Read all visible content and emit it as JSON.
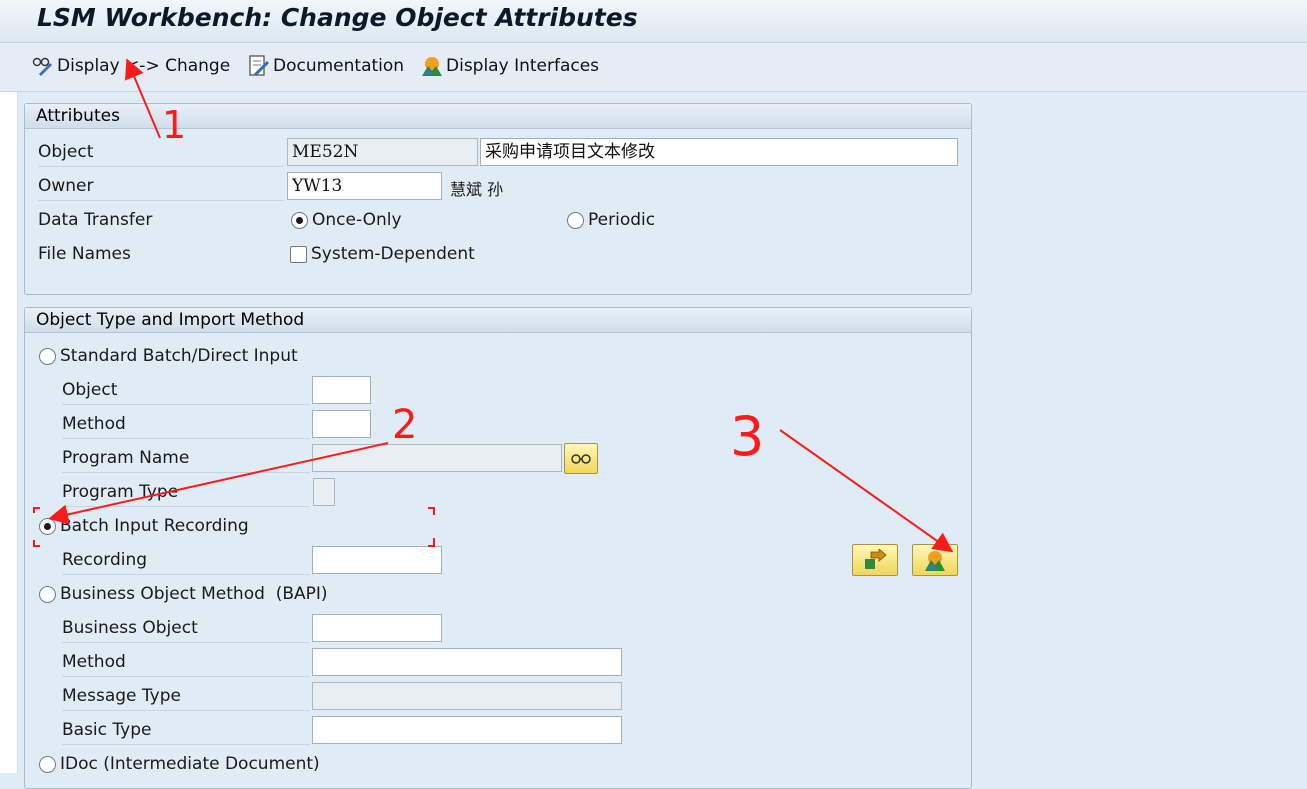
{
  "window": {
    "title": "LSM Workbench: Change Object Attributes"
  },
  "toolbar": {
    "display_change": "Display <-> Change",
    "documentation": "Documentation",
    "display_interfaces": "Display Interfaces"
  },
  "attributes": {
    "heading": "Attributes",
    "object_label": "Object",
    "object_value": "ME52N",
    "object_desc": "采购申请项目文本修改",
    "owner_label": "Owner",
    "owner_value": "YW13",
    "owner_name": "慧斌 孙",
    "data_transfer_label": "Data Transfer",
    "once_only": "Once-Only",
    "periodic": "Periodic",
    "file_names_label": "File Names",
    "system_dependent": "System-Dependent"
  },
  "import": {
    "heading": "Object Type and Import Method",
    "standard_batch": "Standard Batch/Direct Input",
    "object_label": "Object",
    "method_label": "Method",
    "program_name_label": "Program Name",
    "program_type_label": "Program Type",
    "batch_input_recording": "Batch Input Recording",
    "recording_label": "Recording",
    "business_object_method": "Business Object Method  (BAPI)",
    "business_object_label": "Business Object",
    "bapi_method_label": "Method",
    "message_type_label": "Message Type",
    "basic_type_label": "Basic Type",
    "idoc": "IDoc (Intermediate Document)"
  },
  "state": {
    "data_transfer_selected": "Once-Only",
    "import_method_selected": "Batch Input Recording",
    "system_dependent_checked": false
  },
  "annotations": {
    "one": "1",
    "two": "2",
    "three": "3"
  },
  "colors": {
    "arrow": "#ff1a1a",
    "button_yellow": "#f5e27a",
    "panel": "#dfebf5"
  }
}
